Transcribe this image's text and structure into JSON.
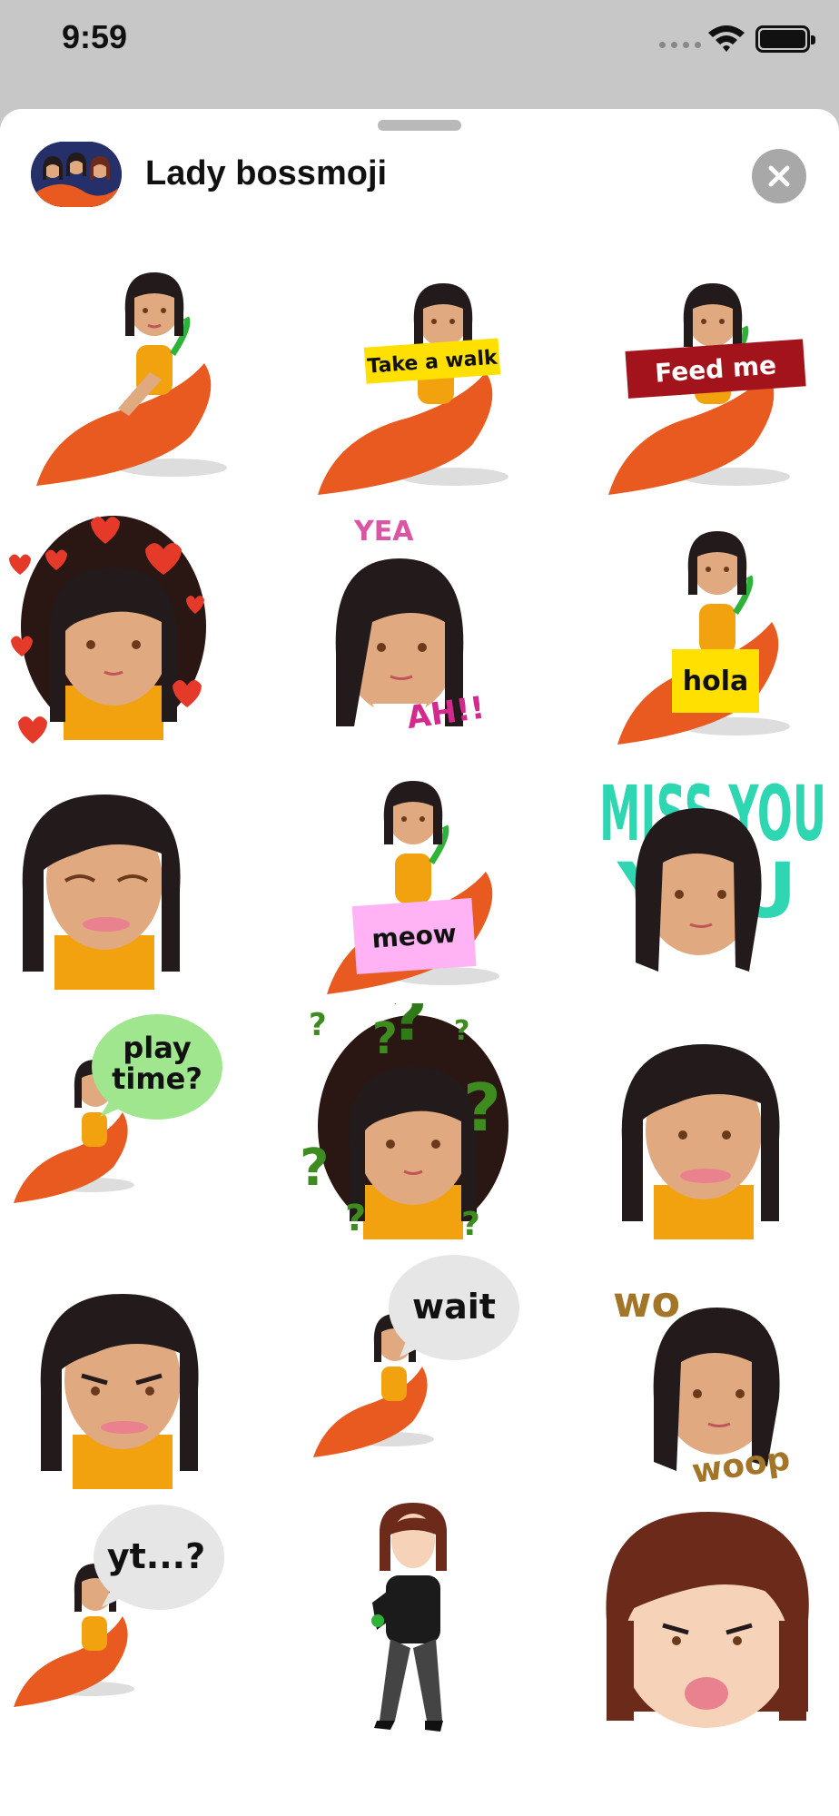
{
  "status_bar": {
    "time": "9:59"
  },
  "header": {
    "title": "Lady bossmoji"
  },
  "colors": {
    "orange": "#e85a1f",
    "hair": "#231b1b",
    "skin": "#e0a97f",
    "green": "#2fb23a",
    "outfit": "#f2a20f",
    "brown_hair": "#6b2a1a"
  },
  "stickers": [
    {
      "name": "sitting-lady",
      "label": ""
    },
    {
      "name": "take-a-walk",
      "label": "Take a walk"
    },
    {
      "name": "feed-me",
      "label": "Feed me"
    },
    {
      "name": "hearts-face",
      "label": ""
    },
    {
      "name": "yeah-face",
      "label": "AH!!"
    },
    {
      "name": "hola",
      "label": "hola"
    },
    {
      "name": "laughing-face",
      "label": ""
    },
    {
      "name": "meow",
      "label": "meow"
    },
    {
      "name": "miss-you",
      "label": "MISS YOU"
    },
    {
      "name": "play-time",
      "label_line1": "play",
      "label_line2": "time?"
    },
    {
      "name": "question-face",
      "label": ""
    },
    {
      "name": "smiling-face",
      "label": ""
    },
    {
      "name": "smirk-face",
      "label": ""
    },
    {
      "name": "wait",
      "label": "wait"
    },
    {
      "name": "woop-face",
      "label_top": "wo",
      "label_bottom": "woop"
    },
    {
      "name": "yt",
      "label": "yt...?"
    },
    {
      "name": "brown-hair-lady",
      "label": ""
    },
    {
      "name": "brown-hair-face",
      "label": ""
    }
  ]
}
